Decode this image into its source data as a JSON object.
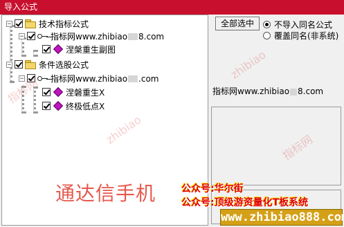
{
  "window": {
    "title": "导入公式"
  },
  "tree": {
    "groups": [
      {
        "label": "技术指标公式",
        "source_prefix": "指标网www.zhibiao",
        "source_suffix": "8.com",
        "items": [
          "涅槃重生副图"
        ]
      },
      {
        "label": "条件选股公式",
        "source_prefix": "指标网www.zhibiao",
        "source_suffix": ".com",
        "items": [
          "涅磐重生X",
          "终极低点X"
        ]
      }
    ]
  },
  "actions": {
    "select_all": "全部选中",
    "opt_skip": "不导入同名公式",
    "opt_overwrite": "覆盖同名(非系统)"
  },
  "info": {
    "source_prefix": "指标网www.zhibiao",
    "source_suffix": "8.com"
  },
  "overlay": {
    "headline": "通达信手机",
    "line1": "公众号:华尔街",
    "line2": "公众号:顶级游资量化T板系统",
    "site": "www.zhibiao888.com",
    "watermark": "指标网",
    "watermark_en": "zhibiao"
  },
  "colors": {
    "titlebar": "#c8102e",
    "formula_icon": "#c014c0",
    "overlay_red": "#e00000"
  }
}
